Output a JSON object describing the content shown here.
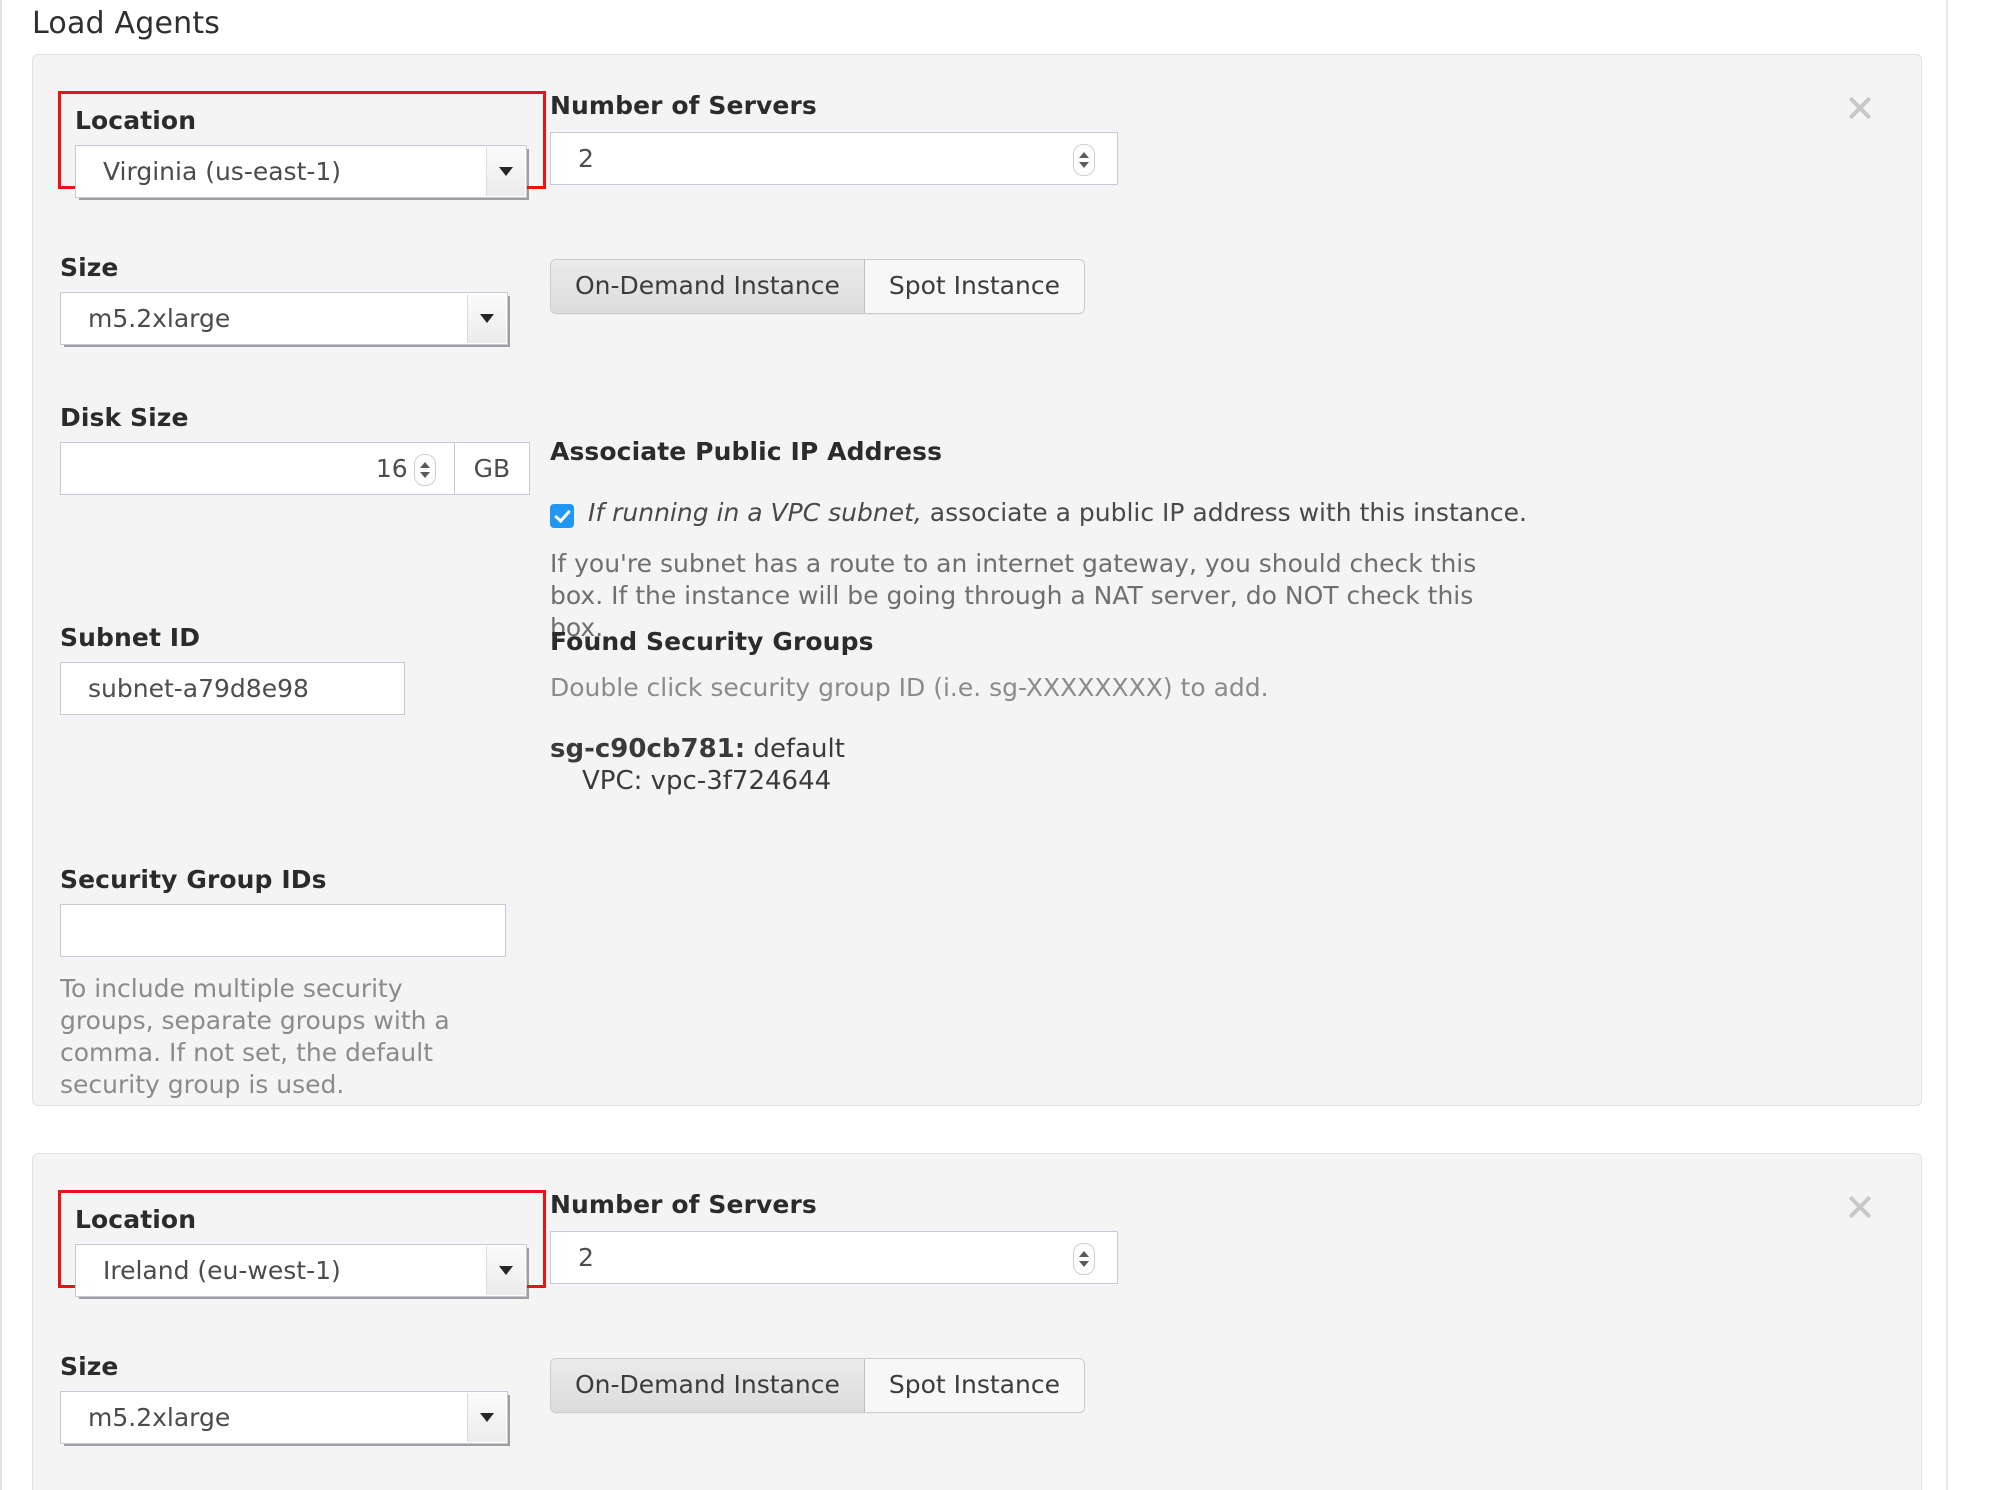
{
  "page": {
    "title": "Load Agents"
  },
  "icons": {
    "close": "close-icon",
    "caret_down": "chevron-down-icon",
    "stepper": "spinner-icon",
    "checkmark": "check-icon"
  },
  "colors": {
    "highlight_outline": "#ee1111",
    "panel_bg": "#f4f4f4",
    "panel_border": "#e2e2e2",
    "checkbox_accent": "#2196f3",
    "help_text": "#8b8b8b"
  },
  "labels": {
    "location": "Location",
    "size": "Size",
    "disk_size": "Disk Size",
    "subnet_id": "Subnet ID",
    "security_group_ids": "Security Group IDs",
    "number_of_servers": "Number of Servers",
    "associate_public_ip": "Associate Public IP Address",
    "found_security_groups": "Found Security Groups",
    "disk_unit": "GB"
  },
  "toggle": {
    "on_demand": "On-Demand Instance",
    "spot": "Spot Instance",
    "selected": "On-Demand Instance"
  },
  "agents": [
    {
      "location": "Virginia (us-east-1)",
      "size": "m5.2xlarge",
      "disk_size": "16",
      "subnet_id": "subnet-a79d8e98",
      "security_group_ids": "",
      "number_of_servers": "2",
      "instance_type_selected": "On-Demand Instance",
      "associate_public_ip_checked": true,
      "checkbox_text_emphasis": "If running in a VPC subnet,",
      "checkbox_text_rest": " associate a public IP address with this instance.",
      "public_ip_help": "If you're subnet has a route to an internet gateway, you should check this box. If the instance will be going through a NAT server, do NOT check this box.",
      "security_group_help": "To include multiple security groups, separate groups with a comma. If not set, the default security group is used.",
      "found_groups_help": "Double click security group ID (i.e. sg-XXXXXXXX) to add.",
      "found_groups": [
        {
          "id": "sg-c90cb781:",
          "name": " default",
          "vpc": "VPC: vpc-3f724644"
        }
      ]
    },
    {
      "location": "Ireland (eu-west-1)",
      "size": "m5.2xlarge",
      "number_of_servers": "2",
      "instance_type_selected": "On-Demand Instance"
    }
  ]
}
